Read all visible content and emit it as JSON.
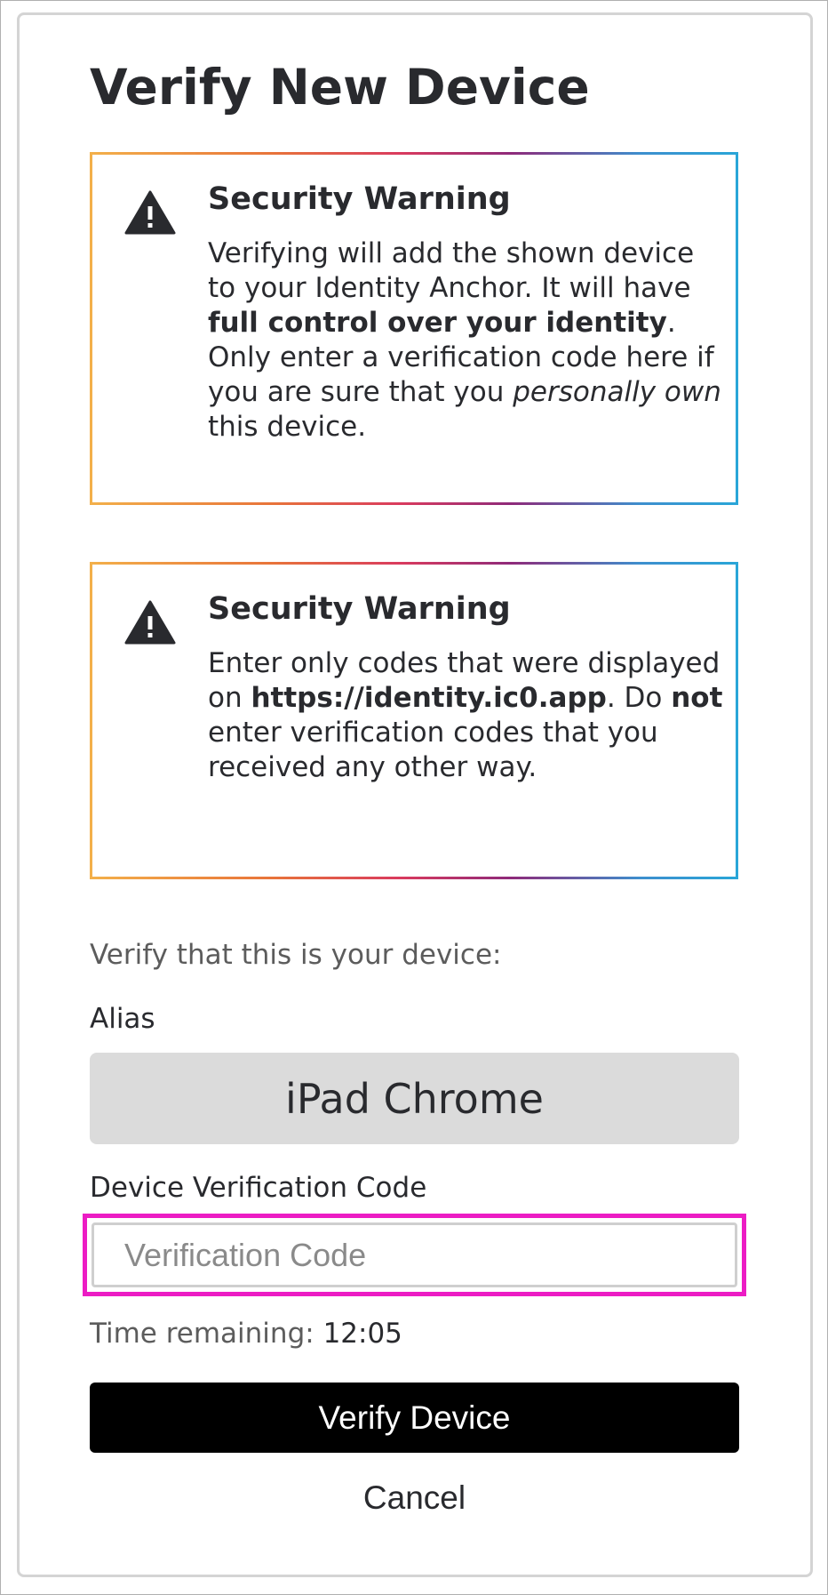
{
  "title": "Verify New Device",
  "warnings": [
    {
      "icon": "warning-triangle-icon",
      "title": "Security Warning",
      "body_parts": [
        {
          "text": "Verifying will add the shown device to your Identity Anchor. It will have ",
          "style": "normal"
        },
        {
          "text": "full control over your identity",
          "style": "bold"
        },
        {
          "text": ". Only enter a verification code here if you are sure that you ",
          "style": "normal"
        },
        {
          "text": "personally own",
          "style": "italic"
        },
        {
          "text": " this device.",
          "style": "normal"
        }
      ]
    },
    {
      "icon": "warning-triangle-icon",
      "title": "Security Warning",
      "body_parts": [
        {
          "text": "Enter only codes that were displayed on ",
          "style": "normal"
        },
        {
          "text": "https://identity.ic0.app",
          "style": "bold"
        },
        {
          "text": ". Do ",
          "style": "normal"
        },
        {
          "text": "not",
          "style": "bold"
        },
        {
          "text": " enter verification codes that you received any other way.",
          "style": "normal"
        }
      ]
    }
  ],
  "lead_text": "Verify that this is your device:",
  "alias": {
    "label": "Alias",
    "value": "iPad Chrome"
  },
  "verification": {
    "label": "Device Verification Code",
    "placeholder": "Verification Code",
    "value": ""
  },
  "timer": {
    "label": "Time remaining:",
    "value": "12:05"
  },
  "buttons": {
    "verify": "Verify Device",
    "cancel": "Cancel"
  },
  "colors": {
    "gradient": [
      "#f3b04a",
      "#e8743a",
      "#d93a5e",
      "#8e2a7a",
      "#29a6d8"
    ],
    "highlight": "#ec1cc4",
    "primary_button": "#000000",
    "alias_bg": "#dbdbdb"
  }
}
